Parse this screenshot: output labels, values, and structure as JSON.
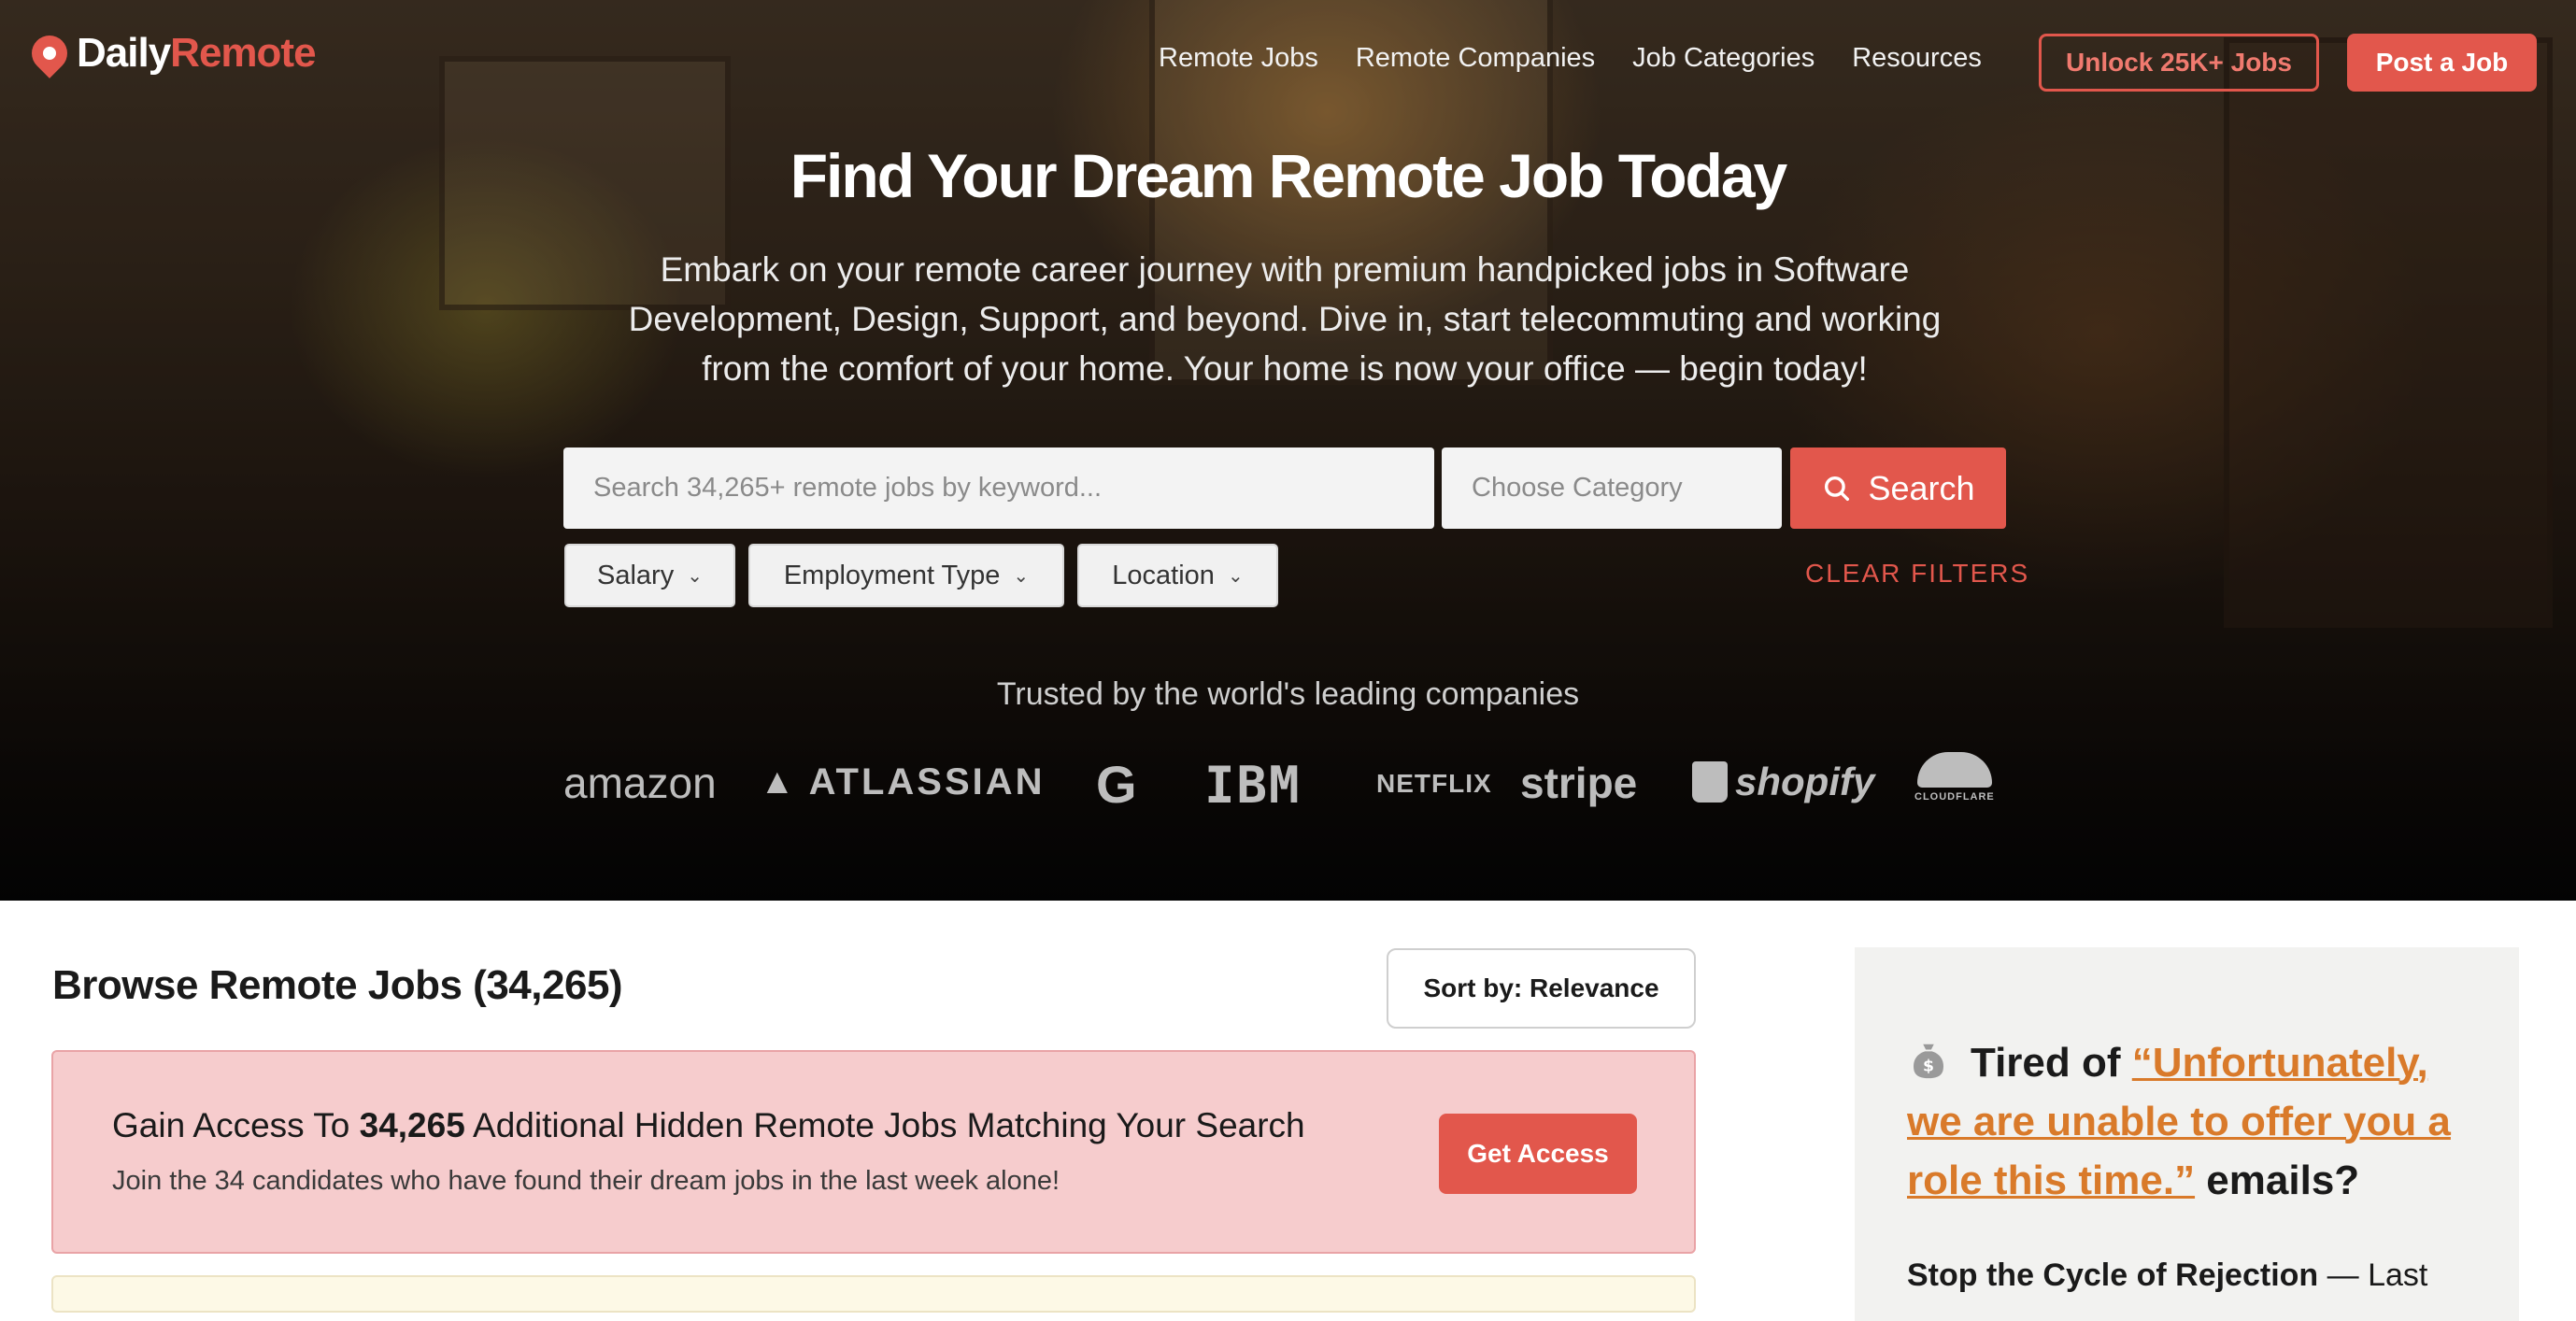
{
  "brand": {
    "name_part1": "Daily",
    "name_part2": "Remote",
    "accent": "#e2574c"
  },
  "nav": {
    "items": [
      {
        "label": "Remote Jobs"
      },
      {
        "label": "Remote Companies"
      },
      {
        "label": "Job Categories"
      },
      {
        "label": "Resources"
      }
    ],
    "unlock_label": "Unlock 25K+ Jobs",
    "post_label": "Post a Job"
  },
  "hero": {
    "title": "Find Your Dream Remote Job Today",
    "subtitle": "Embark on your remote career journey with premium handpicked jobs in Software Development, Design, Support, and beyond. Dive in, start telecommuting and working from the comfort of your home. Your home is now your office — begin today!"
  },
  "search": {
    "placeholder": "Search 34,265+ remote jobs by keyword...",
    "category_placeholder": "Choose Category",
    "button_label": "Search"
  },
  "filters": {
    "items": [
      {
        "label": "Salary"
      },
      {
        "label": "Employment Type"
      },
      {
        "label": "Location"
      }
    ],
    "clear_label": "CLEAR FILTERS"
  },
  "trusted": {
    "label": "Trusted by the world's leading companies",
    "companies": [
      "amazon",
      "ATLASSIAN",
      "G",
      "IBM",
      "NETFLIX",
      "stripe",
      "shopify",
      "CLOUDFLARE"
    ]
  },
  "main": {
    "title": "Browse Remote Jobs (34,265)",
    "sort_label": "Sort by: Relevance",
    "promo": {
      "title_pre": "Gain Access To ",
      "title_count": "34,265",
      "title_post": " Additional Hidden Remote Jobs Matching Your Search",
      "subtitle": "Join the 34 candidates who have found their dream jobs in the last week alone!",
      "button_label": "Get Access"
    }
  },
  "sidebar": {
    "heading_pre": "Tired of ",
    "heading_quote": "“Unfortunately, we are unable to offer you a role this time.”",
    "heading_post": " emails?",
    "sub_bold": "Stop the Cycle of Rejection",
    "sub_rest": " — Last"
  }
}
